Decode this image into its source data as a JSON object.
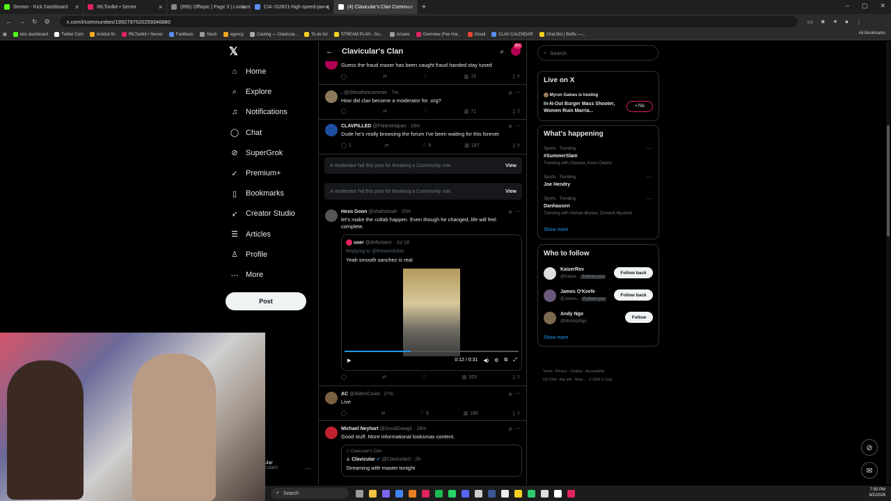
{
  "browser": {
    "tabs": [
      {
        "label": "Stream - Kick Dashboard",
        "color": "#53fc18"
      },
      {
        "label": "IRLToolkit • Server",
        "color": "#e0245e"
      },
      {
        "label": "(896) Offtopic | Page 3 | Looksm",
        "color": "#888888"
      },
      {
        "label": "CIA-152821-high-speed-jaw-q",
        "color": "#5b8def"
      },
      {
        "label": "(4) Clavicular's Clan Commu",
        "color": "#ffffff"
      }
    ],
    "url": "x.com/i/communities/1992797520259346880",
    "bookmarks": [
      {
        "label": "kick dashboard",
        "color": "#53fc18"
      },
      {
        "label": "Twitter Com",
        "color": "#ffffff"
      },
      {
        "label": "kickbot tts",
        "color": "#f5a623"
      },
      {
        "label": "IRLToolkit • Server",
        "color": "#e0245e"
      },
      {
        "label": "FanBasis",
        "color": "#5b8def"
      },
      {
        "label": "Slash",
        "color": "#999999"
      },
      {
        "label": "egency",
        "color": "#f5a623"
      },
      {
        "label": "Casting — Clavicula...",
        "color": "#aaaaaa"
      },
      {
        "label": "To do list",
        "color": "#f5d020"
      },
      {
        "label": "STREAM PLAN - Go...",
        "color": "#f5d020"
      },
      {
        "label": "Arcane",
        "color": "#999999"
      },
      {
        "label": "Overview (Fee Har...",
        "color": "#e0245e"
      },
      {
        "label": "Gmail",
        "color": "#ea4335"
      },
      {
        "label": "CLAV CALENDAR",
        "color": "#5b8def"
      },
      {
        "label": "Chat Bot | Botfix —...",
        "color": "#f5d020"
      }
    ],
    "all_bookmarks": "All Bookmarks"
  },
  "nav": {
    "items": [
      {
        "label": "Home",
        "icon": "home-icon",
        "glyph": "⌂"
      },
      {
        "label": "Explore",
        "icon": "search-icon",
        "glyph": "⌕"
      },
      {
        "label": "Notifications",
        "icon": "bell-icon",
        "glyph": "♫"
      },
      {
        "label": "Chat",
        "icon": "chat-icon",
        "glyph": "◯"
      },
      {
        "label": "SuperGrok",
        "icon": "grok-icon",
        "glyph": "⊘"
      },
      {
        "label": "Premium+",
        "icon": "premium-icon",
        "glyph": "✓"
      },
      {
        "label": "Bookmarks",
        "icon": "bookmark-icon",
        "glyph": "▯"
      },
      {
        "label": "Creator Studio",
        "icon": "rocket-icon",
        "glyph": "➶"
      },
      {
        "label": "Articles",
        "icon": "articles-icon",
        "glyph": "☰"
      },
      {
        "label": "Profile",
        "icon": "profile-icon",
        "glyph": "♙"
      },
      {
        "label": "More",
        "icon": "more-icon",
        "glyph": "⋯"
      }
    ],
    "post_label": "Post",
    "account_name": "ular",
    "account_handle": "cular0"
  },
  "header": {
    "title": "Clavicular's Clan",
    "badge": "20+"
  },
  "feed": {
    "t0": {
      "text": "Guess the fraud maxer has been caught fraud handed stay tuned",
      "views": "72"
    },
    "t1": {
      "name": ".",
      "handle": "@Ottosthescammer · 7m",
      "text": "How did clav become a moderator for .org?",
      "views": "71"
    },
    "t2": {
      "name": "CLAVPILLED",
      "handle": "@Palantirlapan · 19m",
      "text": "Dude he's really browsing the forum I've been waiting for this forever",
      "replies": "1",
      "likes": "8",
      "views": "197"
    },
    "hidden_text": "A moderator hid this post for breaking a Community rule.",
    "hidden_view": "View",
    "t3": {
      "name": "Hexo Goon",
      "handle": "@shahshoah · 25m",
      "text": "let's make the collab happen. Even though he changed, life will feel complete.",
      "views": "325",
      "quote_name": "user",
      "quote_handle": "@defectator · Jul 18",
      "quote_reply": "Replying to @theworldsfair",
      "quote_text": "Yeah smooth sanchez is real",
      "video_time": "0:12 / 0:31",
      "video_progress": 0.38
    },
    "t4": {
      "name": "AC",
      "handle": "@AldenCoula · 27m",
      "text": "Live",
      "likes": "5",
      "views": "180"
    },
    "t5": {
      "name": "Michael Neyhart",
      "handle": "@DuvalDawg1 · 28m",
      "text": "Good stuff. More informational looksmax content.",
      "quote_community": "Clavicular's Clan",
      "quote_name": "Clavicular",
      "quote_handle": "@Clavicular0 · 2h",
      "quote_text": "Streaming with master tonight"
    }
  },
  "sidebar": {
    "search_placeholder": "Search",
    "live_title": "Live on X",
    "live_host": "Myron Gaines is hosting",
    "live_title_text": "In-N-Out Burger Mass Shooter, Women Ruin Marria...",
    "live_count": "+755",
    "happening_title": "What's happening",
    "trends": [
      {
        "meta": "Sports · Trending",
        "name": "#SummerSlam",
        "extra": "Trending with Chelsea, Kevin Owens"
      },
      {
        "meta": "Sports · Trending",
        "name": "Joe Hendry",
        "extra": ""
      },
      {
        "meta": "Sports · Trending",
        "name": "Danhausen",
        "extra": "Trending with Human Monies, Dominik Mysterio"
      }
    ],
    "show_more": "Show more",
    "follow_title": "Who to follow",
    "follow": [
      {
        "name": "KaizerRev",
        "handle": "@Kaizer...",
        "tag": "Follows you",
        "button": "Follow back"
      },
      {
        "name": "James O'Keefe",
        "handle": "@James...",
        "tag": "Follows you",
        "button": "Follow back"
      },
      {
        "name": "Andy Ngo",
        "handle": "@MrAndyNgo",
        "tag": "",
        "button": "Follow"
      }
    ],
    "footer1": "Terms · Privacy · Cookies · Accessibility",
    "footer2": "US TIDA · Ads info · More... · © 2026 X Corp."
  },
  "taskbar": {
    "search": "Search",
    "time": "7:50 PM",
    "date": "8/2/2026"
  }
}
